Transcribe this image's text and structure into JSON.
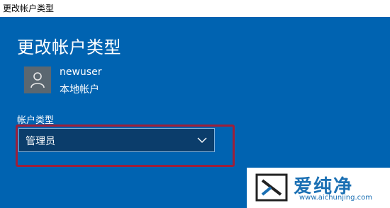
{
  "window": {
    "title": "更改帐户类型"
  },
  "page": {
    "title": "更改帐户类型"
  },
  "user": {
    "name": "newuser",
    "type": "本地帐户"
  },
  "account_type": {
    "label": "帐户类型",
    "selected": "管理员"
  },
  "watermark": {
    "brand": "爱纯净",
    "url": "www.aichunjing.com"
  },
  "colors": {
    "panel": "#0063b1",
    "highlight": "#9c1f3a",
    "select_bg": "#0b3d6b"
  },
  "icons": {
    "avatar": "user-icon",
    "dropdown": "chevron-down-icon"
  }
}
